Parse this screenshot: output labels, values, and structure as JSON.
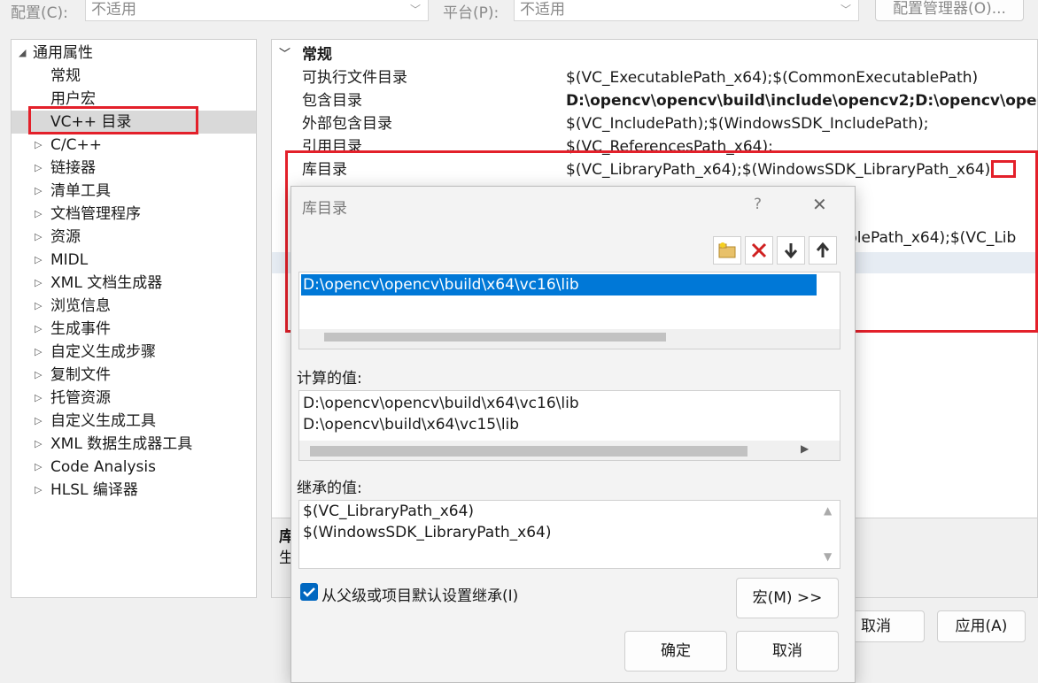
{
  "top_bar": {
    "config_label": "配置(C):",
    "config_value": "不适用",
    "platform_label": "平台(P):",
    "platform_value": "不适用",
    "config_manager_button": "配置管理器(O)..."
  },
  "tree": {
    "root": "通用属性",
    "items": [
      "常规",
      "用户宏",
      "VC++ 目录",
      "C/C++",
      "链接器",
      "清单工具",
      "文档管理程序",
      "资源",
      "MIDL",
      "XML 文档生成器",
      "浏览信息",
      "生成事件",
      "自定义生成步骤",
      "复制文件",
      "托管资源",
      "自定义生成工具",
      "XML 数据生成器工具",
      "Code Analysis",
      "HLSL 编译器"
    ],
    "selected": "VC++ 目录"
  },
  "grid": {
    "section": "常规",
    "rows": [
      {
        "name": "可执行文件目录",
        "value": "$(VC_ExecutablePath_x64);$(CommonExecutablePath)"
      },
      {
        "name": "包含目录",
        "value": "D:\\opencv\\opencv\\build\\include\\opencv2;D:\\opencv\\ope"
      },
      {
        "name": "外部包含目录",
        "value": "$(VC_IncludePath);$(WindowsSDK_IncludePath);"
      },
      {
        "name": "引用目录",
        "value": "$(VC_ReferencesPath_x64);"
      },
      {
        "name": "库目录",
        "value": "$(VC_LibraryPath_x64);$(WindowsSDK_LibraryPath_x64)"
      }
    ],
    "partial_value": "blePath_x64);$(VC_Lib",
    "desc_title": "库",
    "desc_text": "生"
  },
  "dialog": {
    "title": "库目录",
    "help": "?",
    "close": "✕",
    "list_items": [
      "D:\\opencv\\opencv\\build\\x64\\vc16\\lib"
    ],
    "computed_label": "计算的值:",
    "computed_values": [
      "D:\\opencv\\opencv\\build\\x64\\vc16\\lib",
      "D:\\opencv\\build\\x64\\vc15\\lib"
    ],
    "inherited_label": "继承的值:",
    "inherited_values": [
      "$(VC_LibraryPath_x64)",
      "$(WindowsSDK_LibraryPath_x64)"
    ],
    "inherit_checkbox": "从父级或项目默认设置继承(I)",
    "macro_button": "宏(M) >>",
    "ok_button": "确定",
    "cancel_button": "取消"
  },
  "bottom_buttons": {
    "cancel": "取消",
    "apply": "应用(A)"
  },
  "colors": {
    "selection": "#0078d7",
    "highlight_box": "#e3202a",
    "tree_selected_bg": "#d9d9d9"
  }
}
